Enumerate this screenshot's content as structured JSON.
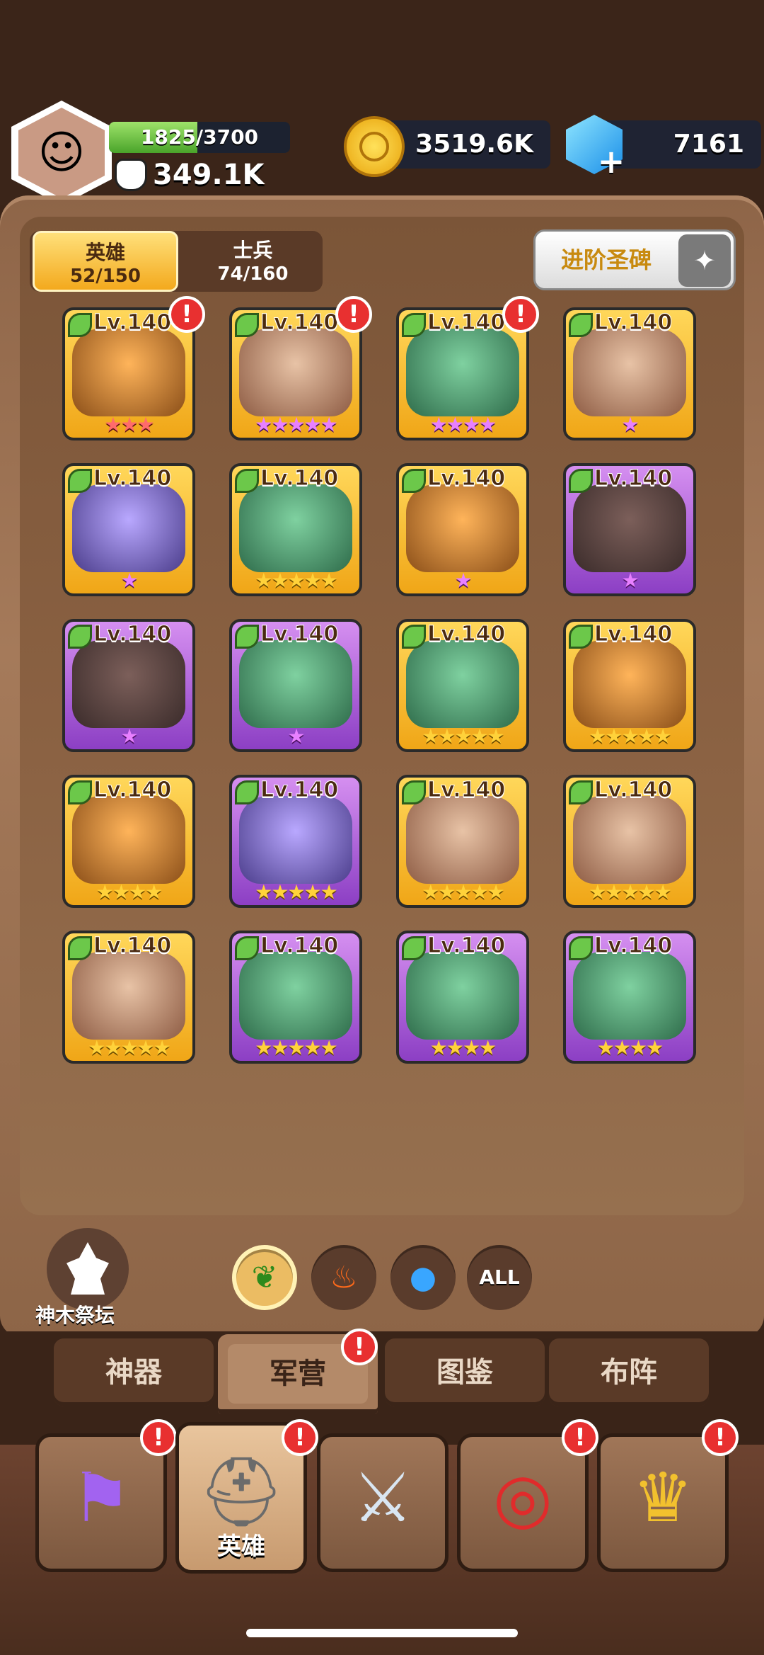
{
  "player": {
    "xp_text": "1825/3700",
    "xp_fraction": 0.49,
    "power": "349.1K"
  },
  "currencies": {
    "gold": "3519.6K",
    "gems": "7161"
  },
  "segments": {
    "heroes_label": "英雄",
    "heroes_count": "52/150",
    "soldiers_label": "士兵",
    "soldiers_count": "74/160"
  },
  "advance_button": "进阶圣碑",
  "heroes": [
    {
      "level": "Lv.140",
      "frame": "gold",
      "portrait": "orange",
      "stars": "★★★",
      "star_color": "red",
      "alert": true
    },
    {
      "level": "Lv.140",
      "frame": "gold",
      "portrait": "default",
      "stars": "★★★★★",
      "star_color": "pink",
      "alert": true
    },
    {
      "level": "Lv.140",
      "frame": "gold",
      "portrait": "green",
      "stars": "★★★★",
      "star_color": "pink",
      "alert": true
    },
    {
      "level": "Lv.140",
      "frame": "gold",
      "portrait": "default",
      "stars": "★",
      "star_color": "pink",
      "alert": false
    },
    {
      "level": "Lv.140",
      "frame": "gold",
      "portrait": "blue",
      "stars": "★",
      "star_color": "pink",
      "alert": false
    },
    {
      "level": "Lv.140",
      "frame": "gold",
      "portrait": "green",
      "stars": "★★★★★",
      "star_color": "gold",
      "alert": false
    },
    {
      "level": "Lv.140",
      "frame": "gold",
      "portrait": "orange",
      "stars": "★",
      "star_color": "pink",
      "alert": false
    },
    {
      "level": "Lv.140",
      "frame": "purple",
      "portrait": "dark",
      "stars": "★",
      "star_color": "pink",
      "alert": false
    },
    {
      "level": "Lv.140",
      "frame": "purple",
      "portrait": "dark",
      "stars": "★",
      "star_color": "pink",
      "alert": false
    },
    {
      "level": "Lv.140",
      "frame": "purple",
      "portrait": "green",
      "stars": "★",
      "star_color": "pink",
      "alert": false
    },
    {
      "level": "Lv.140",
      "frame": "gold",
      "portrait": "green",
      "stars": "★★★★★",
      "star_color": "gold",
      "alert": false
    },
    {
      "level": "Lv.140",
      "frame": "gold",
      "portrait": "orange",
      "stars": "★★★★★",
      "star_color": "gold",
      "alert": false
    },
    {
      "level": "Lv.140",
      "frame": "gold",
      "portrait": "orange",
      "stars": "★★★★",
      "star_color": "gold",
      "alert": false
    },
    {
      "level": "Lv.140",
      "frame": "purple",
      "portrait": "blue",
      "stars": "★★★★★",
      "star_color": "gold",
      "alert": false
    },
    {
      "level": "Lv.140",
      "frame": "gold",
      "portrait": "default",
      "stars": "★★★★★",
      "star_color": "gold",
      "alert": false
    },
    {
      "level": "Lv.140",
      "frame": "gold",
      "portrait": "default",
      "stars": "★★★★★",
      "star_color": "gold",
      "alert": false
    },
    {
      "level": "Lv.140",
      "frame": "gold",
      "portrait": "default",
      "stars": "★★★★★",
      "star_color": "gold",
      "alert": false
    },
    {
      "level": "Lv.140",
      "frame": "purple",
      "portrait": "green",
      "stars": "★★★★★",
      "star_color": "gold",
      "alert": false
    },
    {
      "level": "Lv.140",
      "frame": "purple",
      "portrait": "green",
      "stars": "★★★★",
      "star_color": "gold",
      "alert": false
    },
    {
      "level": "Lv.140",
      "frame": "purple",
      "portrait": "green",
      "stars": "★★★★",
      "star_color": "gold",
      "alert": false
    }
  ],
  "altar_label": "神木祭坛",
  "filters": {
    "all_label": "ALL"
  },
  "tabs": [
    "神器",
    "军营",
    "图鉴",
    "布阵"
  ],
  "bottom_nav": {
    "hero_label": "英雄"
  },
  "colors": {
    "accent_gold": "#f3a91d",
    "alert_red": "#e83030",
    "panel_brown": "#a57a5a"
  }
}
